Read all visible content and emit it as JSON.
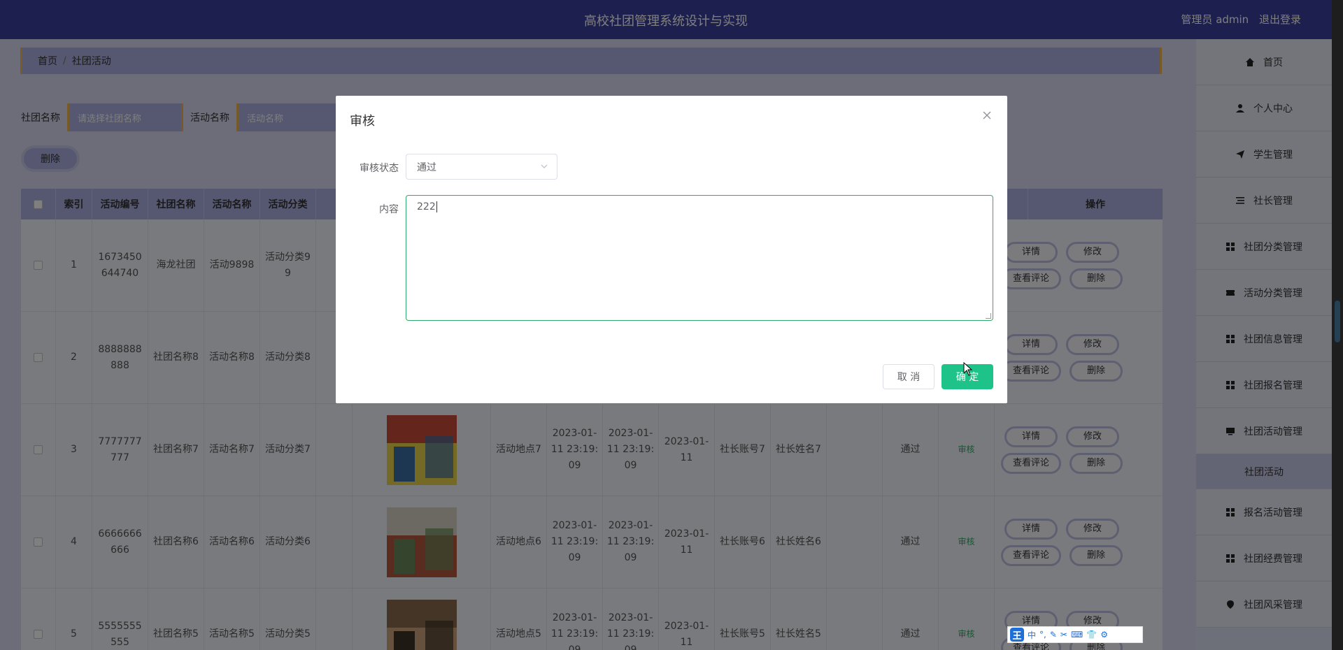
{
  "header": {
    "title": "高校社团管理系统设计与实现",
    "user_label": "管理员 admin",
    "logout_label": "退出登录"
  },
  "breadcrumb": {
    "home": "首页",
    "sep": "/",
    "current": "社团活动"
  },
  "search": {
    "club_label": "社团名称",
    "club_placeholder": "请选择社团名称",
    "activity_label": "活动名称",
    "activity_placeholder": "活动名称"
  },
  "actions": {
    "delete_label": "删除"
  },
  "table": {
    "headers": {
      "index": "索引",
      "code": "活动编号",
      "club": "社团名称",
      "name": "活动名称",
      "category": "活动分类",
      "ops": "操作"
    },
    "op_labels": {
      "detail": "详情",
      "edit": "修改",
      "comments": "查看评论",
      "delete": "删除"
    },
    "rows": [
      {
        "index": "1",
        "code": "1673450644740",
        "club": "海龙社团",
        "name": "活动9898",
        "category": "活动分类99",
        "place": "",
        "start": "",
        "end": "",
        "date": "",
        "account": "",
        "leader": "",
        "status": "",
        "audit": ""
      },
      {
        "index": "2",
        "code": "8888888888",
        "club": "社团名称8",
        "name": "活动名称8",
        "category": "活动分类8",
        "place": "",
        "start": "",
        "end": "",
        "date": "",
        "account": "",
        "leader": "",
        "status": "",
        "audit": ""
      },
      {
        "index": "3",
        "code": "7777777777",
        "club": "社团名称7",
        "name": "活动名称7",
        "category": "活动分类7",
        "place": "活动地点7",
        "start": "2023-01-11 23:19:09",
        "end": "2023-01-11 23:19:09",
        "date": "2023-01-11",
        "account": "社长账号7",
        "leader": "社长姓名7",
        "status": "通过",
        "audit": "审核"
      },
      {
        "index": "4",
        "code": "6666666666",
        "club": "社团名称6",
        "name": "活动名称6",
        "category": "活动分类6",
        "place": "活动地点6",
        "start": "2023-01-11 23:19:09",
        "end": "2023-01-11 23:19:09",
        "date": "2023-01-11",
        "account": "社长账号6",
        "leader": "社长姓名6",
        "status": "通过",
        "audit": "审核"
      },
      {
        "index": "5",
        "code": "5555555555",
        "club": "社团名称5",
        "name": "活动名称5",
        "category": "活动分类5",
        "place": "活动地点5",
        "start": "2023-01-11 23:19:09",
        "end": "2023-01-11 23:19:09",
        "date": "2023-01-11",
        "account": "社长账号5",
        "leader": "社长姓名5",
        "status": "通过",
        "audit": "审核"
      }
    ]
  },
  "sidebar": {
    "items": [
      {
        "label": "首页",
        "icon": "home-icon"
      },
      {
        "label": "个人中心",
        "icon": "user-icon"
      },
      {
        "label": "学生管理",
        "icon": "send-icon"
      },
      {
        "label": "社长管理",
        "icon": "list-icon"
      },
      {
        "label": "社团分类管理",
        "icon": "grid-icon"
      },
      {
        "label": "活动分类管理",
        "icon": "ticket-icon"
      },
      {
        "label": "社团信息管理",
        "icon": "grid-icon"
      },
      {
        "label": "社团报名管理",
        "icon": "grid-icon"
      },
      {
        "label": "社团活动管理",
        "icon": "monitor-icon"
      },
      {
        "label": "社团活动",
        "icon": ""
      },
      {
        "label": "报名活动管理",
        "icon": "grid-icon"
      },
      {
        "label": "社团经费管理",
        "icon": "grid-icon"
      },
      {
        "label": "社团风采管理",
        "icon": "pin-icon"
      }
    ]
  },
  "dialog": {
    "title": "审核",
    "status_label": "审核状态",
    "status_value": "通过",
    "content_label": "内容",
    "content_value": "222",
    "cancel_label": "取 消",
    "ok_label": "确 定"
  },
  "ime": {
    "logo": "王",
    "mode": "中"
  }
}
